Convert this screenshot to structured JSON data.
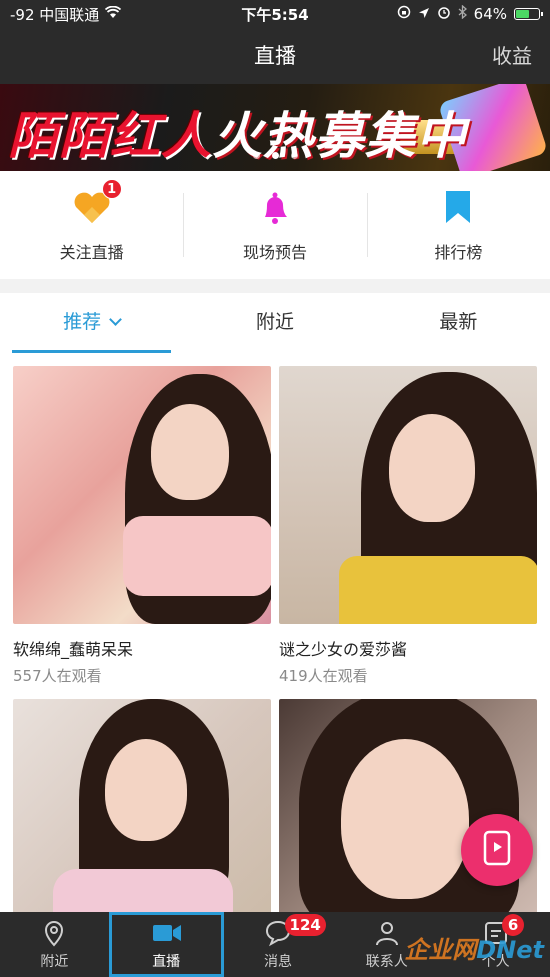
{
  "status_bar": {
    "carrier": "-92 中国联通",
    "time": "下午5:54",
    "battery_pct": "64%",
    "battery_level": 0.64,
    "icons": [
      "wifi-icon",
      "lock-rotation-icon",
      "location-icon",
      "alarm-icon",
      "bluetooth-icon",
      "battery-icon"
    ]
  },
  "nav": {
    "title": "直播",
    "right_action": "收益"
  },
  "banner": {
    "text_part1": "陌陌红人",
    "text_part2": "火热募集中",
    "page_count": 3,
    "active_page": 2
  },
  "quick_actions": [
    {
      "label": "关注直播",
      "icon": "heart-icon",
      "badge": "1",
      "color": "#f5a623"
    },
    {
      "label": "现场预告",
      "icon": "bell-icon",
      "color": "#e62ad6"
    },
    {
      "label": "排行榜",
      "icon": "bookmark-icon",
      "color": "#25a9e8"
    }
  ],
  "tabs": [
    {
      "label": "推荐",
      "active": true
    },
    {
      "label": "附近",
      "active": false
    },
    {
      "label": "最新",
      "active": false
    }
  ],
  "streams": [
    {
      "name": "软绵绵_蠢萌呆呆",
      "viewers": "557人在观看"
    },
    {
      "name": "谜之少女の爱莎酱",
      "viewers": "419人在观看"
    },
    {
      "name": "",
      "viewers": ""
    },
    {
      "name": "",
      "viewers": ""
    }
  ],
  "fab": {
    "icon": "phone-live-icon"
  },
  "tab_bar": [
    {
      "label": "附近",
      "icon": "location-pin-icon"
    },
    {
      "label": "直播",
      "icon": "video-camera-icon",
      "active": true
    },
    {
      "label": "消息",
      "icon": "chat-bubble-icon",
      "badge": "124"
    },
    {
      "label": "联系人",
      "icon": "person-icon"
    },
    {
      "label": "个人",
      "icon": "profile-card-icon",
      "badge": "6"
    }
  ],
  "watermark": {
    "part1": "企业网",
    "part2": "D",
    "part3": "Net"
  },
  "colors": {
    "accent": "#2a9bd6",
    "bar": "#2b2b2b",
    "badge": "#e8212f",
    "fab": "#ec2f6d"
  }
}
